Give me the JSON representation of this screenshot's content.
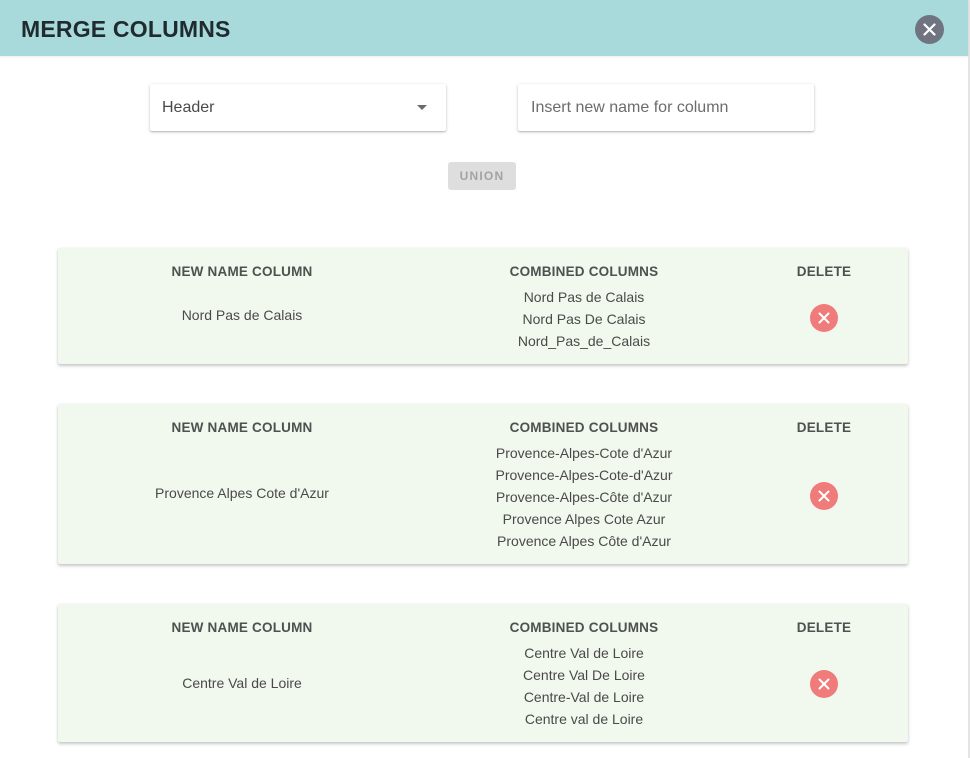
{
  "dialog": {
    "title": "MERGE COLUMNS",
    "close_icon": "close-icon"
  },
  "controls": {
    "select_value": "Header",
    "name_placeholder": "Insert new name for column",
    "union_label": "UNION",
    "union_disabled": true
  },
  "table_headers": {
    "name": "NEW NAME COLUMN",
    "combined": "COMBINED COLUMNS",
    "delete": "DELETE"
  },
  "merges": [
    {
      "name": "Nord Pas de Calais",
      "columns": [
        "Nord Pas de Calais",
        "Nord Pas De Calais",
        "Nord_Pas_de_Calais"
      ]
    },
    {
      "name": "Provence Alpes Cote d'Azur",
      "columns": [
        "Provence-Alpes-Cote d'Azur",
        "Provence-Alpes-Cote-d'Azur",
        "Provence-Alpes-Côte d'Azur",
        "Provence Alpes Cote Azur",
        "Provence Alpes Côte d'Azur"
      ]
    },
    {
      "name": "Centre Val de Loire",
      "columns": [
        "Centre Val de Loire",
        "Centre Val De Loire",
        "Centre-Val de Loire",
        "Centre val de Loire"
      ]
    }
  ],
  "colors": {
    "header_bg": "#a8dadc",
    "card_bg": "#f1f8ee",
    "delete_red": "#f07b7b",
    "close_grey": "#6f7480"
  }
}
